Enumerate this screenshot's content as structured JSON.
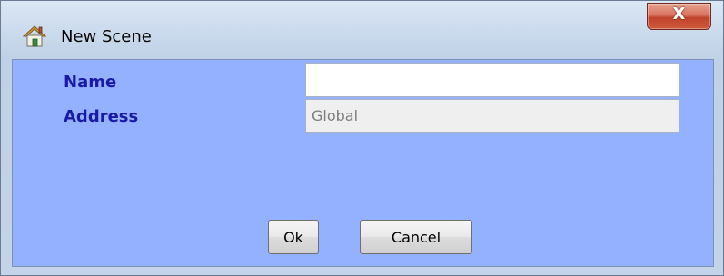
{
  "window": {
    "title": "New Scene",
    "close_label": "X"
  },
  "form": {
    "name_label": "Name",
    "name_value": "",
    "address_label": "Address",
    "address_value": "Global"
  },
  "buttons": {
    "ok_label": "Ok",
    "cancel_label": "Cancel"
  },
  "colors": {
    "panel_background": "#94b1ff",
    "label_text": "#1a1aa8",
    "close_button": "#c0432b"
  },
  "icons": {
    "title_icon": "home-icon"
  }
}
